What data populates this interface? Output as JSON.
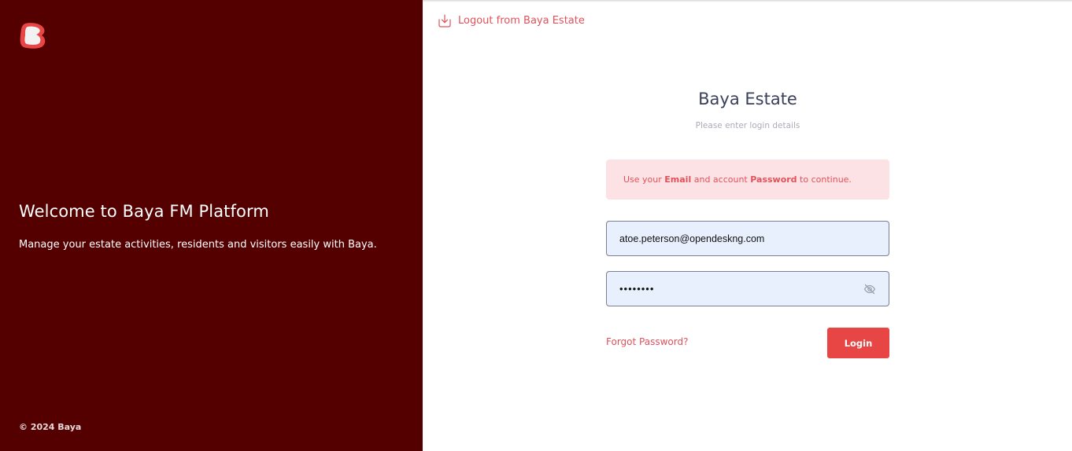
{
  "brand": {
    "logo_icon": "baya-logo-icon",
    "panel_color": "#550000",
    "accent_color": "#e84545"
  },
  "left_panel": {
    "welcome_title": "Welcome to Baya FM Platform",
    "welcome_subtitle": "Manage your estate activities, residents and visitors easily with Baya.",
    "copyright": "© 2024 Baya"
  },
  "header": {
    "logout_label": "Logout from Baya Estate",
    "logout_icon": "logout-download-icon"
  },
  "login_form": {
    "title": "Baya Estate",
    "subtitle": "Please enter login details",
    "alert": {
      "prefix": "Use your ",
      "email_word": "Email",
      "middle": " and account ",
      "password_word": "Password",
      "suffix": " to continue."
    },
    "email_value": "atoe.peterson@opendeskng.com",
    "password_value": "••••••••",
    "password_toggle_icon": "eye-slash-icon",
    "forgot_password_label": "Forgot Password?",
    "login_label": "Login"
  }
}
